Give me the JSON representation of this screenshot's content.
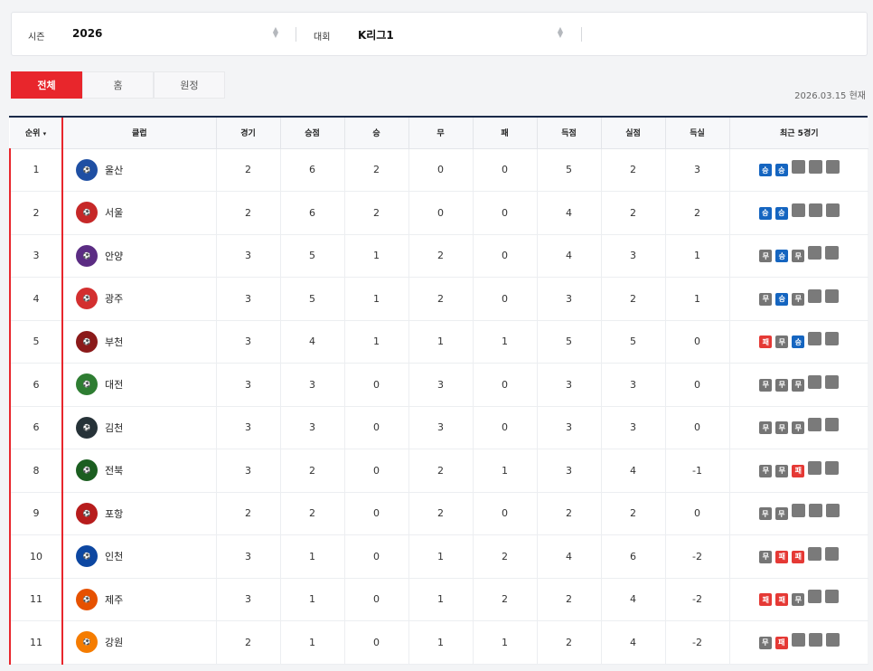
{
  "filters": {
    "season_label": "시즌",
    "season_value": "2026",
    "league_label": "대회",
    "league_value": "K리그1"
  },
  "tabs": [
    {
      "label": "전체",
      "active": true
    },
    {
      "label": "홈",
      "active": false
    },
    {
      "label": "원정",
      "active": false
    }
  ],
  "as_of": "2026.03.15 현재",
  "columns": {
    "rank": "순위",
    "rank_sort": "▾",
    "club": "클럽",
    "played": "경기",
    "points": "승점",
    "win": "승",
    "draw": "무",
    "loss": "패",
    "gf": "득점",
    "ga": "실점",
    "gd": "득실",
    "recent": "최근 5경기"
  },
  "result_labels": {
    "W": "승",
    "D": "무",
    "L": "패"
  },
  "rows": [
    {
      "rank": "1",
      "club": "울산",
      "logo_color": "#1f4fa3",
      "played": "2",
      "points": "6",
      "win": "2",
      "draw": "0",
      "loss": "0",
      "gf": "5",
      "ga": "2",
      "gd": "3",
      "recent": [
        "W",
        "W"
      ]
    },
    {
      "rank": "2",
      "club": "서울",
      "logo_color": "#c62828",
      "played": "2",
      "points": "6",
      "win": "2",
      "draw": "0",
      "loss": "0",
      "gf": "4",
      "ga": "2",
      "gd": "2",
      "recent": [
        "W",
        "W"
      ]
    },
    {
      "rank": "3",
      "club": "안양",
      "logo_color": "#5b2c83",
      "played": "3",
      "points": "5",
      "win": "1",
      "draw": "2",
      "loss": "0",
      "gf": "4",
      "ga": "3",
      "gd": "1",
      "recent": [
        "D",
        "W",
        "D"
      ]
    },
    {
      "rank": "4",
      "club": "광주",
      "logo_color": "#d32f2f",
      "played": "3",
      "points": "5",
      "win": "1",
      "draw": "2",
      "loss": "0",
      "gf": "3",
      "ga": "2",
      "gd": "1",
      "recent": [
        "D",
        "W",
        "D"
      ]
    },
    {
      "rank": "5",
      "club": "부천",
      "logo_color": "#8b1a1a",
      "played": "3",
      "points": "4",
      "win": "1",
      "draw": "1",
      "loss": "1",
      "gf": "5",
      "ga": "5",
      "gd": "0",
      "recent": [
        "L",
        "D",
        "W"
      ]
    },
    {
      "rank": "6",
      "club": "대전",
      "logo_color": "#2e7d32",
      "played": "3",
      "points": "3",
      "win": "0",
      "draw": "3",
      "loss": "0",
      "gf": "3",
      "ga": "3",
      "gd": "0",
      "recent": [
        "D",
        "D",
        "D"
      ]
    },
    {
      "rank": "6",
      "club": "김천",
      "logo_color": "#263238",
      "played": "3",
      "points": "3",
      "win": "0",
      "draw": "3",
      "loss": "0",
      "gf": "3",
      "ga": "3",
      "gd": "0",
      "recent": [
        "D",
        "D",
        "D"
      ]
    },
    {
      "rank": "8",
      "club": "전북",
      "logo_color": "#1b5e20",
      "played": "3",
      "points": "2",
      "win": "0",
      "draw": "2",
      "loss": "1",
      "gf": "3",
      "ga": "4",
      "gd": "-1",
      "recent": [
        "D",
        "D",
        "L"
      ]
    },
    {
      "rank": "9",
      "club": "포항",
      "logo_color": "#b71c1c",
      "played": "2",
      "points": "2",
      "win": "0",
      "draw": "2",
      "loss": "0",
      "gf": "2",
      "ga": "2",
      "gd": "0",
      "recent": [
        "D",
        "D"
      ]
    },
    {
      "rank": "10",
      "club": "인천",
      "logo_color": "#0d47a1",
      "played": "3",
      "points": "1",
      "win": "0",
      "draw": "1",
      "loss": "2",
      "gf": "4",
      "ga": "6",
      "gd": "-2",
      "recent": [
        "D",
        "L",
        "L"
      ]
    },
    {
      "rank": "11",
      "club": "제주",
      "logo_color": "#e65100",
      "played": "3",
      "points": "1",
      "win": "0",
      "draw": "1",
      "loss": "2",
      "gf": "2",
      "ga": "4",
      "gd": "-2",
      "recent": [
        "L",
        "L",
        "D"
      ]
    },
    {
      "rank": "11",
      "club": "강원",
      "logo_color": "#f57c00",
      "played": "2",
      "points": "1",
      "win": "0",
      "draw": "1",
      "loss": "1",
      "gf": "2",
      "ga": "4",
      "gd": "-2",
      "recent": [
        "D",
        "L"
      ]
    }
  ]
}
